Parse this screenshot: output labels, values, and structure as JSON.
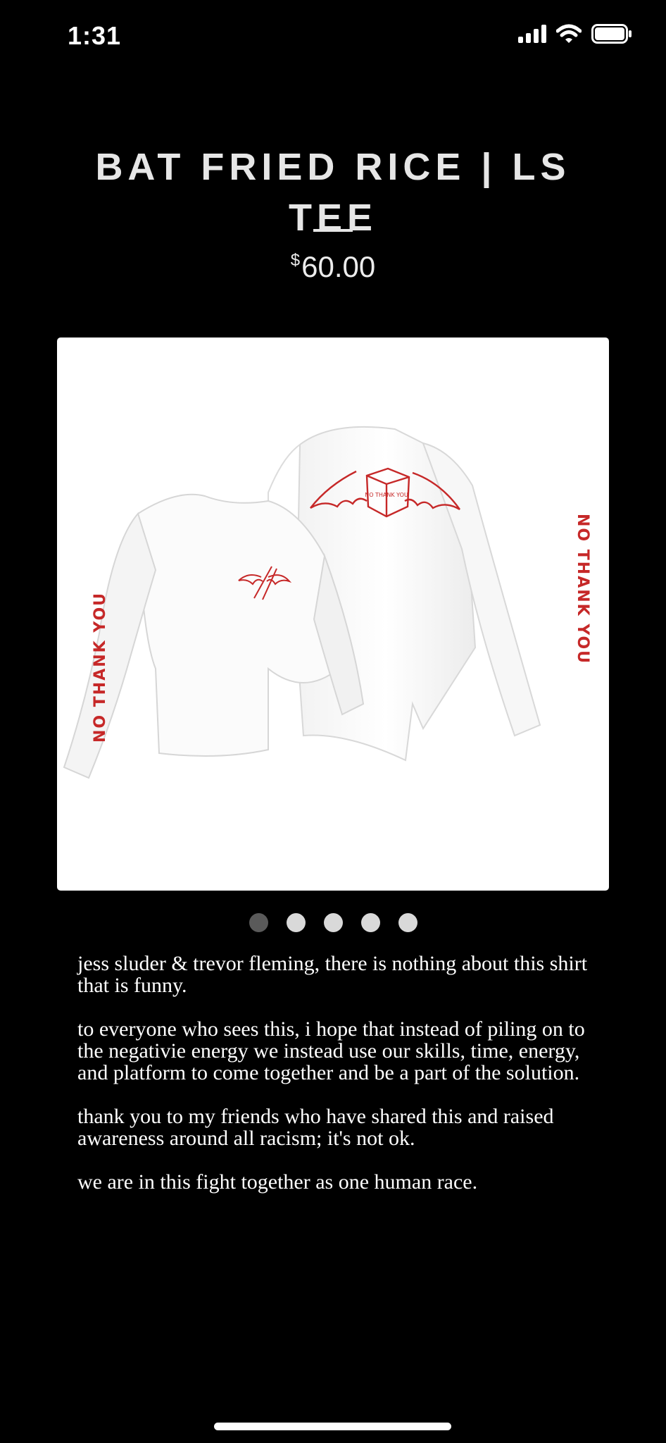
{
  "status_bar": {
    "time": "1:31",
    "icons": [
      "cellular-signal-icon",
      "wifi-icon",
      "battery-icon"
    ]
  },
  "product": {
    "title": "BAT FRIED RICE | LS TEE",
    "currency_symbol": "$",
    "price": "60.00",
    "image_alt": "White long sleeve tee with red bat takeout box graphic",
    "sleeve_text_left": "NO THANK YOU",
    "sleeve_text_right": "NO THANK YOU",
    "box_text": "NO THANK YOU"
  },
  "carousel": {
    "count": 5,
    "active_index": 0
  },
  "description": {
    "paragraphs": [
      "jess sluder & trevor fleming, there is nothing about this shirt that is funny.",
      "to everyone who sees this, i hope that instead of piling on to the negativie energy we instead use our skills, time, energy, and platform to come together and be a part of the solution.",
      "thank you to my friends who have shared this and raised awareness around all racism; it's not ok.",
      "we are in this fight together as one human race."
    ]
  },
  "colors": {
    "background": "#000000",
    "text": "#ffffff",
    "print_red": "#c62828",
    "dot_active": "#5a5a5a",
    "dot_inactive": "#d9d9d9"
  }
}
